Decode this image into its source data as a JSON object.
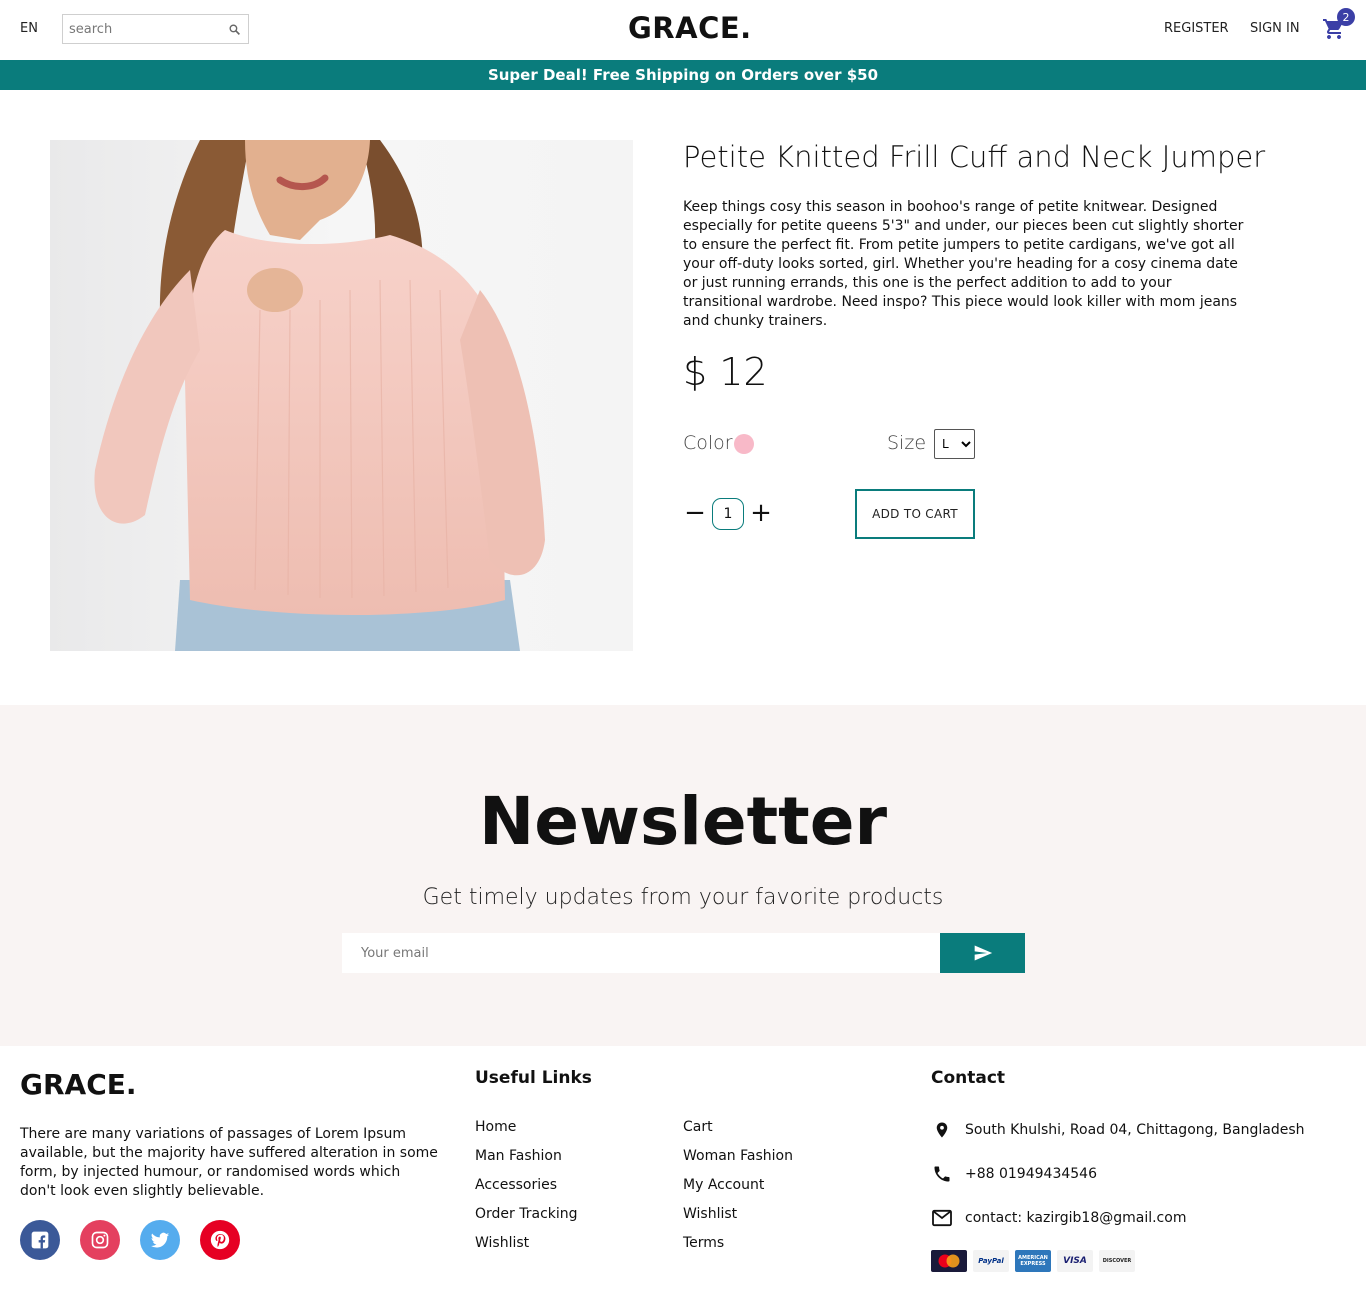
{
  "header": {
    "lang": "EN",
    "search_placeholder": "search",
    "logo": "GRACE.",
    "register": "REGISTER",
    "sign_in": "SIGN IN",
    "cart_count": "2"
  },
  "announcement": "Super Deal! Free Shipping on Orders over $50",
  "product": {
    "title": "Petite Knitted Frill Cuff and Neck Jumper",
    "description": "Keep things cosy this season in boohoo's range of petite knitwear. Designed especially for petite queens 5'3\" and under, our pieces been cut slightly shorter to ensure the perfect fit. From petite jumpers to petite cardigans, we've got all your off-duty looks sorted, girl. Whether you're heading for a cosy cinema date or just running errands, this one is the perfect addition to add to your transitional wardrobe. Need inspo? This piece would look killer with mom jeans and chunky trainers.",
    "price": "$ 12",
    "color_label": "Color",
    "color_value": "#f8b9c8",
    "size_label": "Size",
    "size_value": "L",
    "quantity": "1",
    "minus": "−",
    "plus": "+",
    "add_to_cart": "ADD TO CART"
  },
  "newsletter": {
    "title": "Newsletter",
    "subtitle": "Get timely updates from your favorite products",
    "email_placeholder": "Your email"
  },
  "footer": {
    "logo": "GRACE.",
    "description": "There are many variations of passages of Lorem Ipsum available, but the majority have suffered alteration in some form, by injected humour, or randomised words which don't look even slightly believable.",
    "useful_links_title": "Useful Links",
    "links_col1": [
      "Home",
      "Man Fashion",
      "Accessories",
      "Order Tracking",
      "Wishlist"
    ],
    "links_col2": [
      "Cart",
      "Woman Fashion",
      "My Account",
      "Wishlist",
      "Terms"
    ],
    "contact_title": "Contact",
    "address": "South Khulshi, Road 04, Chittagong, Bangladesh",
    "phone": "+88 01949434546",
    "email": "contact: kazirgib18@gmail.com",
    "payments": [
      "MasterCard",
      "PayPal",
      "American Express",
      "VISA",
      "DISCOVER"
    ]
  },
  "colors": {
    "accent": "#0a7c7c",
    "badge": "#3b3fa6",
    "newsletter_bg": "#f9f4f3"
  }
}
